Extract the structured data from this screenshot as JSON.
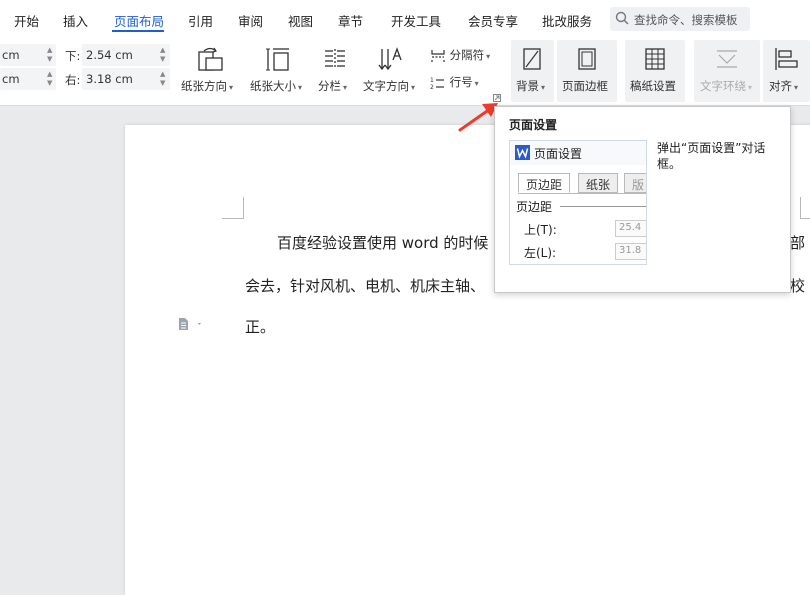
{
  "menubar": {
    "tabs": [
      "开始",
      "插入",
      "页面布局",
      "引用",
      "审阅",
      "视图",
      "章节",
      "开发工具",
      "会员专享",
      "批改服务"
    ],
    "active": "页面布局",
    "search_placeholder": "查找命令、搜索模板"
  },
  "ribbon": {
    "margin_left_unit_top": "cm",
    "margin_left_unit_bottom": "cm",
    "margin_bottom_label": "下:",
    "margin_bottom_value": "2.54 cm",
    "margin_right_label": "右:",
    "margin_right_value": "3.18 cm",
    "buttons": {
      "orientation": "纸张方向",
      "size": "纸张大小",
      "columns": "分栏",
      "text_direction": "文字方向",
      "separator": "分隔符",
      "line_number": "行号",
      "background": "背景",
      "page_border": "页面边框",
      "manuscript": "稿纸设置",
      "text_wrap": "文字环绕",
      "align": "对齐"
    }
  },
  "document": {
    "line1": "百度经验设置使用 word 的时候",
    "line1_tail": "部",
    "line2": "会去，针对风机、电机、机床主轴、",
    "line2_tail": "校",
    "line3": "正。"
  },
  "tooltip": {
    "title": "页面设置",
    "description": "弹出“页面设置”对话框。",
    "dialog_title": "页面设置",
    "tab_margins": "页边距",
    "tab_paper": "纸张",
    "tab_third": "版",
    "section": "页边距",
    "top_label": "上(T):",
    "top_value": "25.4",
    "left_label": "左(L):",
    "left_value": "31.8"
  },
  "colors": {
    "accent": "#1d5fcf",
    "wps_logo": "#2a5cc9",
    "annotation_arrow": "#ee3b2b"
  }
}
